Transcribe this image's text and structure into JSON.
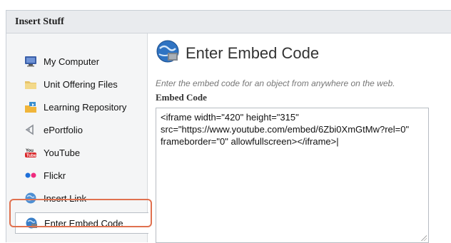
{
  "dialog": {
    "title": "Insert Stuff"
  },
  "sidebar": {
    "items": [
      {
        "label": "My Computer",
        "icon": "computer-icon"
      },
      {
        "label": "Unit Offering Files",
        "icon": "folder-icon"
      },
      {
        "label": "Learning Repository",
        "icon": "repository-icon"
      },
      {
        "label": "ePortfolio",
        "icon": "eportfolio-icon"
      },
      {
        "label": "YouTube",
        "icon": "youtube-icon"
      },
      {
        "label": "Flickr",
        "icon": "flickr-icon"
      },
      {
        "label": "Insert Link",
        "icon": "link-globe-icon"
      },
      {
        "label": "Enter Embed Code",
        "icon": "embed-globe-icon",
        "selected": true
      }
    ]
  },
  "main": {
    "title": "Enter Embed Code",
    "description": "Enter the embed code for an object from anywhere on the web.",
    "field_label": "Embed Code",
    "embed_value": "<iframe width=\"420\" height=\"315\"\nsrc=\"https://www.youtube.com/embed/6Zbi0XmGtMw?rel=0\"\nframeborder=\"0\" allowfullscreen></iframe>|"
  },
  "colors": {
    "highlight": "#e0714f",
    "header_bg": "#e9ebee",
    "sidebar_bg": "#f4f5f6"
  }
}
